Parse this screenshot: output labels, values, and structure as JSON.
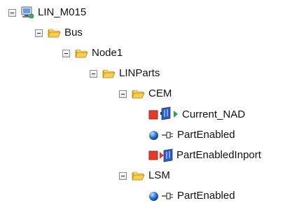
{
  "tree": {
    "root": {
      "label": "LIN_M015",
      "icon": "network-database-icon",
      "expanded": true
    },
    "nodes": [
      {
        "label": "Bus",
        "icon": "folder-icon",
        "expanded": true
      },
      {
        "label": "Node1",
        "icon": "folder-icon",
        "expanded": true
      },
      {
        "label": "LINParts",
        "icon": "folder-icon",
        "expanded": true
      },
      {
        "label": "CEM",
        "icon": "folder-icon",
        "expanded": true
      },
      {
        "label": "Current_NAD",
        "icons": [
          "red-square-icon",
          "blue-module-icon",
          "green-arrow-icon"
        ]
      },
      {
        "label": "PartEnabled",
        "icons": [
          "blue-ball-icon",
          "connector-icon"
        ]
      },
      {
        "label": "PartEnabledInport",
        "icons": [
          "red-square-icon",
          "red-arrow-module-icon"
        ]
      },
      {
        "label": "LSM",
        "icon": "folder-icon",
        "expanded": true
      },
      {
        "label": "PartEnabled",
        "icons": [
          "blue-ball-icon",
          "connector-icon"
        ]
      }
    ]
  },
  "colors": {
    "folder": "#f2c94c",
    "folder_dark": "#c9971a",
    "module_blue": "#2f5db8",
    "ball_blue": "#2b72d6",
    "red": "#e23b2e",
    "green": "#2aa54a"
  }
}
